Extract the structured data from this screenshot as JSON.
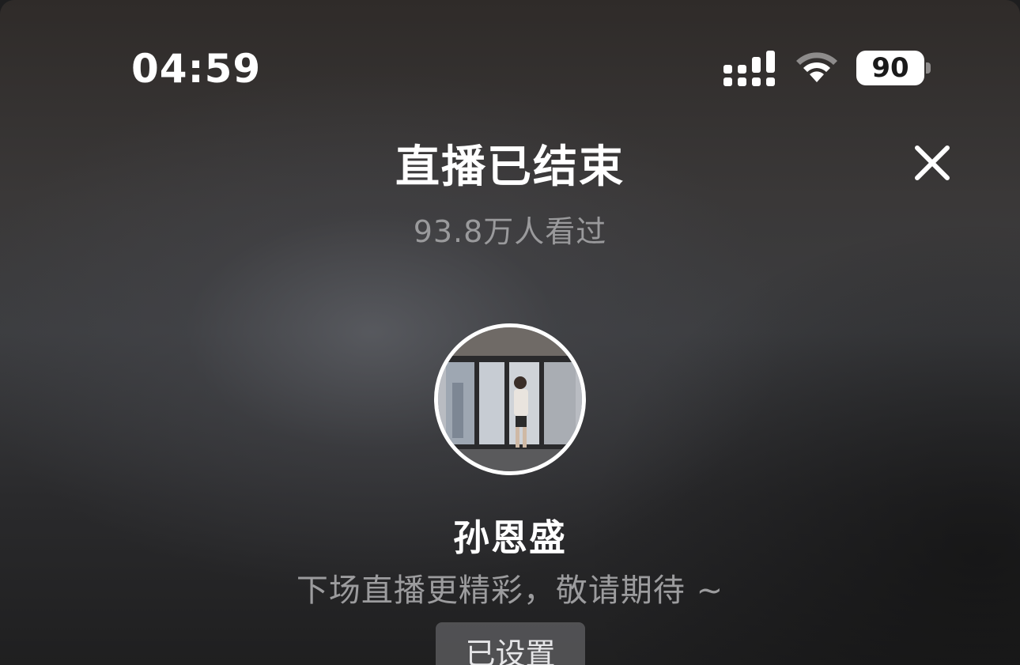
{
  "status_bar": {
    "time": "04:59",
    "battery_level": "90",
    "icons": [
      "signal-icon",
      "wifi-icon",
      "battery-icon"
    ]
  },
  "header": {
    "title": "直播已结束",
    "close_icon": "close-icon"
  },
  "stats": {
    "viewers_text": "93.8万人看过"
  },
  "host": {
    "name": "孙恩盛",
    "message": "下场直播更精彩，敬请期待 ~"
  },
  "reminder": {
    "button_label": "已设置"
  },
  "colors": {
    "text_primary": "#ffffff",
    "text_secondary": "#9a9a9c",
    "button_bg": "#6b6b6f"
  }
}
